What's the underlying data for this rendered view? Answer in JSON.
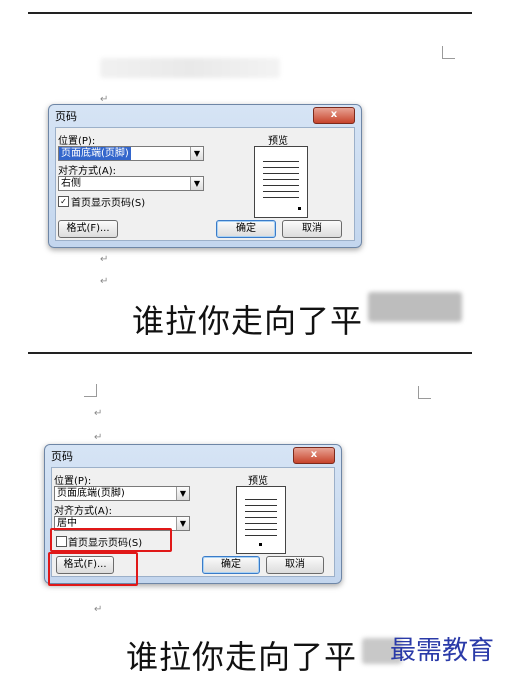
{
  "top": {
    "dialog": {
      "title": "页码",
      "close_label": "x",
      "position_label": "位置(P):",
      "position_value": "页面底端(页脚)",
      "alignment_label": "对齐方式(A):",
      "alignment_value": "右侧",
      "first_page_label": "首页显示页码(S)",
      "first_page_checked": "✓",
      "preview_label": "预览",
      "format_button": "格式(F)...",
      "ok_button": "确定",
      "cancel_button": "取消"
    },
    "body_text": "谁拉你走向了平"
  },
  "bottom": {
    "dialog": {
      "title": "页码",
      "close_label": "x",
      "position_label": "位置(P):",
      "position_value": "页面底端(页脚)",
      "alignment_label": "对齐方式(A):",
      "alignment_value": "居中",
      "first_page_label": "首页显示页码(S)",
      "first_page_checked": "",
      "preview_label": "预览",
      "format_button": "格式(F)...",
      "ok_button": "确定",
      "cancel_button": "取消"
    },
    "body_text": "谁拉你走向了平"
  },
  "watermark": "最需教育",
  "colors": {
    "highlight": "#e01818",
    "watermark": "#2a3aa8",
    "selection": "#3366cc"
  },
  "paragraph_mark": "↵"
}
